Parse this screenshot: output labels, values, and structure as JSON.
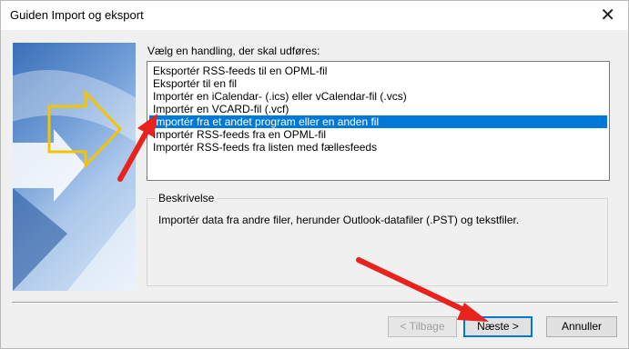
{
  "window": {
    "title": "Guiden Import og eksport",
    "close_glyph": "✕"
  },
  "prompt": "Vælg en handling, der skal udføres:",
  "actions": [
    {
      "label": "Eksportér RSS-feeds til en OPML-fil",
      "selected": false
    },
    {
      "label": "Eksportér til en fil",
      "selected": false
    },
    {
      "label": "Importér en iCalendar- (.ics) eller vCalendar-fil (.vcs)",
      "selected": false
    },
    {
      "label": "Importér en VCARD-fil (.vcf)",
      "selected": false
    },
    {
      "label": "Importér fra et andet program eller en anden fil",
      "selected": true
    },
    {
      "label": "Importér RSS-feeds fra en OPML-fil",
      "selected": false
    },
    {
      "label": "Importér RSS-feeds fra listen med fællesfeeds",
      "selected": false
    }
  ],
  "description": {
    "legend": "Beskrivelse",
    "text": "Importér data fra andre filer, herunder Outlook-datafiler (.PST) og tekstfiler."
  },
  "buttons": {
    "back": "< Tilbage",
    "next": "Næste >",
    "cancel": "Annuller"
  },
  "colors": {
    "selection": "#0078d7",
    "annotation_arrow": "#e8221c"
  }
}
